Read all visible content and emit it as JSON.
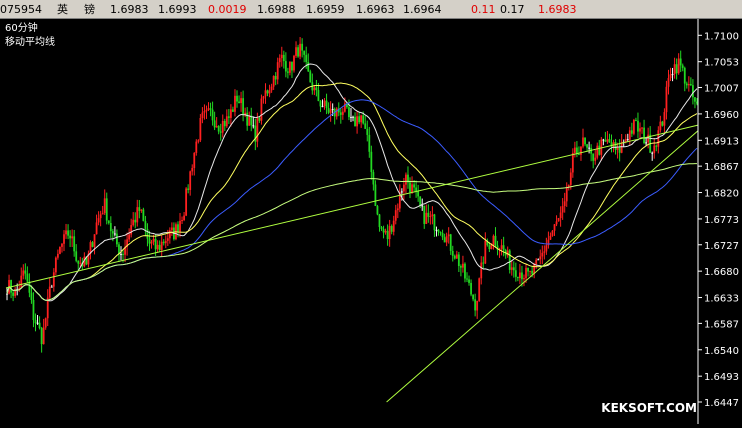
{
  "quote_bar": {
    "code": "075954",
    "name_1": "英",
    "name_2": "镑",
    "open": "1.6983",
    "high": "1.6993",
    "change": "0.0019",
    "low": "1.6988",
    "prev": "1.6959",
    "bid": "1.6963",
    "ask": "1.6964",
    "change_pct": "0.11",
    "amplitude": "0.17",
    "last": "1.6983"
  },
  "captions": {
    "period": "60分钟",
    "indicator": "移动平均线"
  },
  "watermark": "KEKSOFT.COM",
  "colors": {
    "up_candle": "#ff2020",
    "down_candle": "#22d822",
    "neutral_candle": "#ffffff",
    "ma_white": "#e8e8e8",
    "ma_yellow": "#ffff60",
    "ma_blue": "#3b5cff",
    "ma_light_green": "#c8ff80",
    "trendline": "#b0ff40",
    "axis": "#ffffff"
  },
  "chart_data": {
    "type": "candlestick",
    "ylim": [
      1.6447,
      1.7113
    ],
    "yticks": [
      "1.7100",
      "1.7053",
      "1.7007",
      "1.6960",
      "1.6913",
      "1.6867",
      "1.6820",
      "1.6773",
      "1.6727",
      "1.6680",
      "1.6633",
      "1.6587",
      "1.6540",
      "1.6493",
      "1.6447"
    ],
    "close_path": [
      1.6655,
      1.664,
      1.668,
      1.66,
      1.656,
      1.666,
      1.672,
      1.675,
      1.67,
      1.669,
      1.676,
      1.68,
      1.674,
      1.671,
      1.676,
      1.679,
      1.673,
      1.672,
      1.674,
      1.675,
      1.679,
      1.688,
      1.695,
      1.696,
      1.694,
      1.695,
      1.699,
      1.696,
      1.692,
      1.699,
      1.702,
      1.706,
      1.704,
      1.708,
      1.703,
      1.699,
      1.697,
      1.696,
      1.697,
      1.694,
      1.696,
      1.689,
      1.676,
      1.674,
      1.679,
      1.685,
      1.682,
      1.678,
      1.677,
      1.676,
      1.673,
      1.67,
      1.666,
      1.662,
      1.672,
      1.674,
      1.672,
      1.669,
      1.668,
      1.667,
      1.669,
      1.673,
      1.676,
      1.679,
      1.688,
      1.691,
      1.688,
      1.69,
      1.691,
      1.689,
      1.692,
      1.694,
      1.692,
      1.69,
      1.694,
      1.704,
      1.705,
      1.701,
      1.697
    ],
    "moving_averages": [
      {
        "color_key": "ma_white",
        "window": 5
      },
      {
        "color_key": "ma_yellow",
        "window": 10
      },
      {
        "color_key": "ma_blue",
        "window": 20
      },
      {
        "color_key": "ma_light_green",
        "window": 60
      }
    ],
    "trendlines": [
      {
        "from": [
          0.0,
          1.665
        ],
        "to": [
          1.0,
          1.694
        ]
      },
      {
        "from": [
          0.55,
          1.6447
        ],
        "to": [
          1.0,
          1.693
        ]
      }
    ],
    "grid": false,
    "legend": "none"
  }
}
